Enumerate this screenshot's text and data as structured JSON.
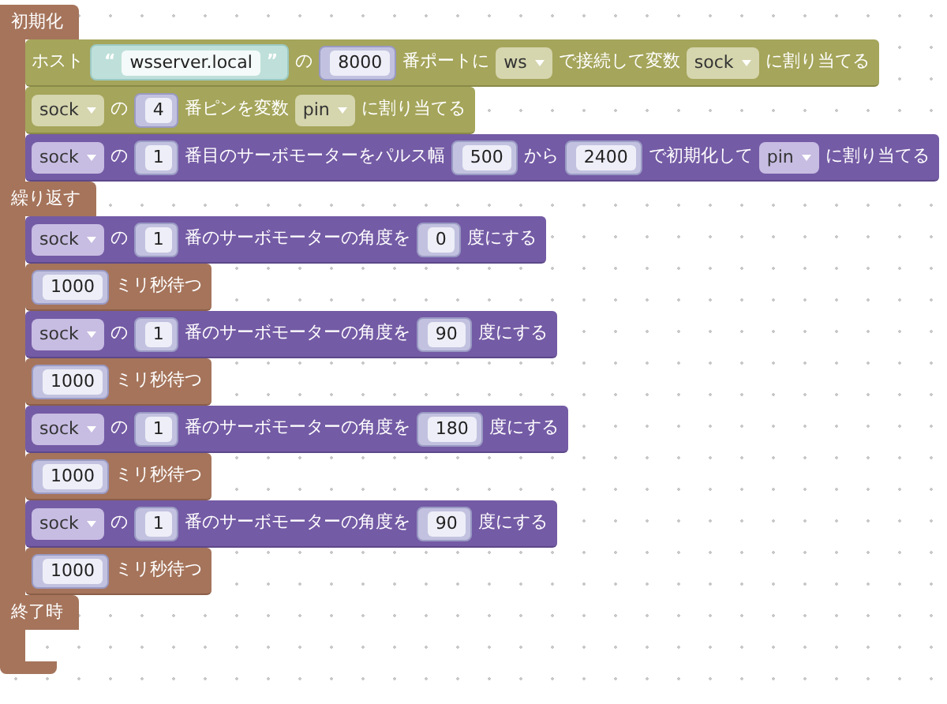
{
  "sections": [
    {
      "label": "初期化",
      "statements": [
        {
          "kind": "network",
          "parts": [
            {
              "kind": "text",
              "text": "ホスト"
            },
            {
              "kind": "string",
              "open_quote": "“",
              "value": "wsserver.local",
              "close_quote": "”"
            },
            {
              "kind": "text",
              "text": "の"
            },
            {
              "kind": "number",
              "value": "8000"
            },
            {
              "kind": "text",
              "text": "番ポートに"
            },
            {
              "kind": "dropdown",
              "value": "ws"
            },
            {
              "kind": "text",
              "text": "で接続して変数"
            },
            {
              "kind": "dropdown",
              "value": "sock"
            },
            {
              "kind": "text",
              "text": "に割り当てる"
            }
          ]
        },
        {
          "kind": "network",
          "parts": [
            {
              "kind": "dropdown",
              "value": "sock"
            },
            {
              "kind": "text",
              "text": "の"
            },
            {
              "kind": "number",
              "value": "4"
            },
            {
              "kind": "text",
              "text": "番ピンを変数"
            },
            {
              "kind": "dropdown",
              "value": "pin"
            },
            {
              "kind": "text",
              "text": "に割り当てる"
            }
          ]
        },
        {
          "kind": "servo",
          "parts": [
            {
              "kind": "dropdown",
              "value": "sock"
            },
            {
              "kind": "text",
              "text": "の"
            },
            {
              "kind": "number",
              "value": "1"
            },
            {
              "kind": "text",
              "text": "番目のサーボモーターをパルス幅"
            },
            {
              "kind": "number",
              "value": "500"
            },
            {
              "kind": "text",
              "text": "から"
            },
            {
              "kind": "number",
              "value": "2400"
            },
            {
              "kind": "text",
              "text": "で初期化して"
            },
            {
              "kind": "dropdown",
              "value": "pin"
            },
            {
              "kind": "text",
              "text": "に割り当てる"
            }
          ]
        }
      ]
    },
    {
      "label": "繰り返す",
      "statements": [
        {
          "kind": "servo",
          "parts": [
            {
              "kind": "dropdown",
              "value": "sock"
            },
            {
              "kind": "text",
              "text": "の"
            },
            {
              "kind": "number",
              "value": "1"
            },
            {
              "kind": "text",
              "text": "番のサーボモーターの角度を"
            },
            {
              "kind": "number",
              "value": "0"
            },
            {
              "kind": "text",
              "text": "度にする"
            }
          ]
        },
        {
          "kind": "timing",
          "parts": [
            {
              "kind": "number",
              "value": "1000"
            },
            {
              "kind": "text",
              "text": "ミリ秒待つ"
            }
          ]
        },
        {
          "kind": "servo",
          "parts": [
            {
              "kind": "dropdown",
              "value": "sock"
            },
            {
              "kind": "text",
              "text": "の"
            },
            {
              "kind": "number",
              "value": "1"
            },
            {
              "kind": "text",
              "text": "番のサーボモーターの角度を"
            },
            {
              "kind": "number",
              "value": "90"
            },
            {
              "kind": "text",
              "text": "度にする"
            }
          ]
        },
        {
          "kind": "timing",
          "parts": [
            {
              "kind": "number",
              "value": "1000"
            },
            {
              "kind": "text",
              "text": "ミリ秒待つ"
            }
          ]
        },
        {
          "kind": "servo",
          "parts": [
            {
              "kind": "dropdown",
              "value": "sock"
            },
            {
              "kind": "text",
              "text": "の"
            },
            {
              "kind": "number",
              "value": "1"
            },
            {
              "kind": "text",
              "text": "番のサーボモーターの角度を"
            },
            {
              "kind": "number",
              "value": "180"
            },
            {
              "kind": "text",
              "text": "度にする"
            }
          ]
        },
        {
          "kind": "timing",
          "parts": [
            {
              "kind": "number",
              "value": "1000"
            },
            {
              "kind": "text",
              "text": "ミリ秒待つ"
            }
          ]
        },
        {
          "kind": "servo",
          "parts": [
            {
              "kind": "dropdown",
              "value": "sock"
            },
            {
              "kind": "text",
              "text": "の"
            },
            {
              "kind": "number",
              "value": "1"
            },
            {
              "kind": "text",
              "text": "番のサーボモーターの角度を"
            },
            {
              "kind": "number",
              "value": "90"
            },
            {
              "kind": "text",
              "text": "度にする"
            }
          ]
        },
        {
          "kind": "timing",
          "parts": [
            {
              "kind": "number",
              "value": "1000"
            },
            {
              "kind": "text",
              "text": "ミリ秒待つ"
            }
          ]
        }
      ]
    },
    {
      "label": "終了時"
    }
  ]
}
